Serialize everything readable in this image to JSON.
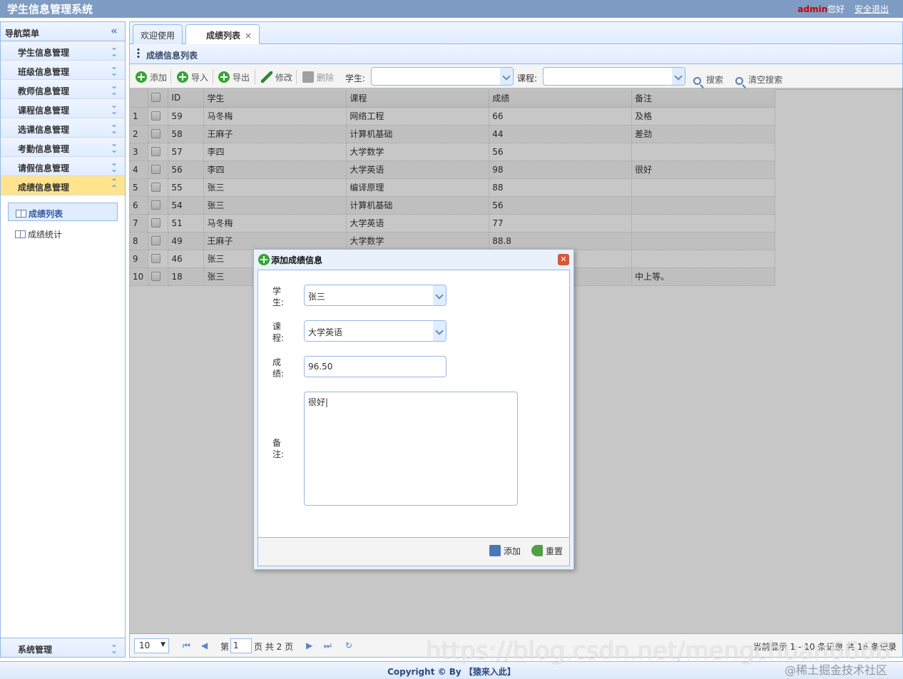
{
  "app": {
    "title": "学生信息管理系统"
  },
  "header": {
    "user": "admin",
    "greeting": "您好",
    "logout": "安全退出"
  },
  "sidebar": {
    "title": "导航菜单",
    "menus": [
      "学生信息管理",
      "班级信息管理",
      "教师信息管理",
      "课程信息管理",
      "选课信息管理",
      "考勤信息管理",
      "请假信息管理",
      "成绩信息管理"
    ],
    "active_menu": "成绩信息管理",
    "sub_items": [
      "成绩列表",
      "成绩统计"
    ],
    "bottom_menu": "系统管理"
  },
  "tabs": [
    {
      "label": "欢迎使用"
    },
    {
      "label": "成绩列表",
      "closable": true
    }
  ],
  "panel": {
    "title": "成绩信息列表"
  },
  "toolbar": {
    "add": "添加",
    "import": "导入",
    "export": "导出",
    "edit": "修改",
    "delete": "删除",
    "student_label": "学生:",
    "course_label": "课程:",
    "search": "搜索",
    "clear": "清空搜索"
  },
  "grid": {
    "columns": [
      "ID",
      "学生",
      "课程",
      "成绩",
      "备注"
    ],
    "rows": [
      {
        "n": "1",
        "id": "59",
        "student": "马冬梅",
        "course": "网络工程",
        "score": "66",
        "note": "及格"
      },
      {
        "n": "2",
        "id": "58",
        "student": "王麻子",
        "course": "计算机基础",
        "score": "44",
        "note": "差劲"
      },
      {
        "n": "3",
        "id": "57",
        "student": "李四",
        "course": "大学数学",
        "score": "56",
        "note": ""
      },
      {
        "n": "4",
        "id": "56",
        "student": "李四",
        "course": "大学英语",
        "score": "98",
        "note": "很好"
      },
      {
        "n": "5",
        "id": "55",
        "student": "张三",
        "course": "编译原理",
        "score": "88",
        "note": ""
      },
      {
        "n": "6",
        "id": "54",
        "student": "张三",
        "course": "计算机基础",
        "score": "56",
        "note": ""
      },
      {
        "n": "7",
        "id": "51",
        "student": "马冬梅",
        "course": "大学英语",
        "score": "77",
        "note": ""
      },
      {
        "n": "8",
        "id": "49",
        "student": "王麻子",
        "course": "大学数学",
        "score": "88.8",
        "note": ""
      },
      {
        "n": "9",
        "id": "46",
        "student": "张三",
        "course": "",
        "score": "",
        "note": ""
      },
      {
        "n": "10",
        "id": "18",
        "student": "张三",
        "course": "",
        "score": "",
        "note": "中上等。"
      }
    ]
  },
  "pager": {
    "page_size": "10",
    "page_prefix": "第",
    "page": "1",
    "page_suffix": "页 共 2 页",
    "info": "当前显示 1 - 10 条记录 共 16 条记录"
  },
  "dialog": {
    "title": "添加成绩信息",
    "student_label": "学生:",
    "student_value": "张三",
    "course_label": "课程:",
    "course_value": "大学英语",
    "score_label": "成绩:",
    "score_value": "96.50",
    "note_label": "备注:",
    "note_value": "很好|",
    "add_button": "添加",
    "reset_button": "重置"
  },
  "footer": {
    "copyright": "Copyright © By 【猿来入此】"
  },
  "watermark": {
    "url": "https://blog.csdn.net/mengchuan6666",
    "community": "@稀土掘金技术社区"
  }
}
